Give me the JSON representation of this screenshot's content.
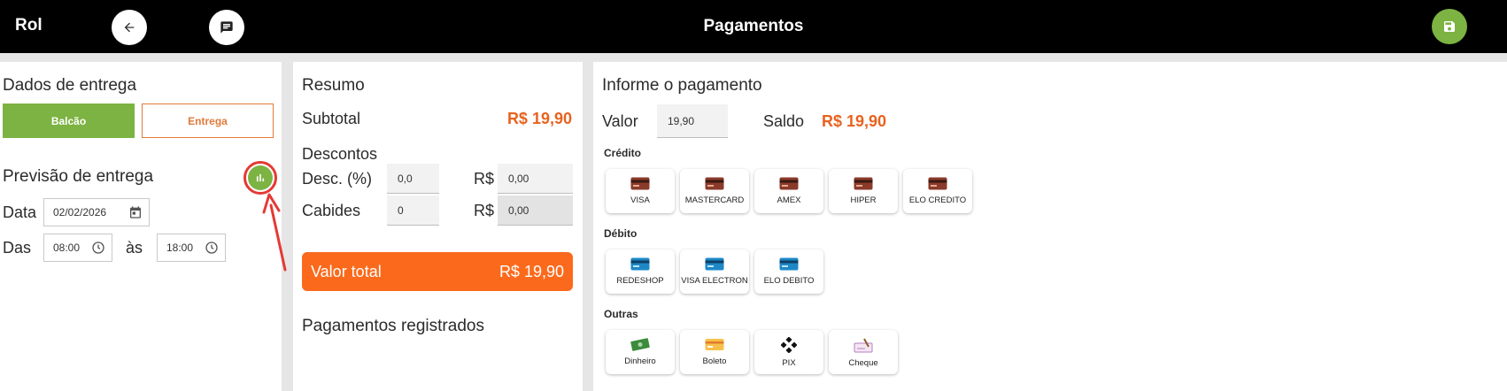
{
  "header": {
    "app_title": "Rol",
    "page_title": "Pagamentos",
    "back_icon": "arrow-left-icon",
    "chat_icon": "chat-icon",
    "save_icon": "save-icon",
    "save_color": "#7cb342"
  },
  "entrega": {
    "title": "Dados de entrega",
    "balcao_label": "Balcão",
    "entrega_label": "Entrega",
    "previsao_title": "Previsão de entrega",
    "data_label": "Data",
    "data_value": "02/02/2026",
    "das_label": "Das",
    "das_value": "08:00",
    "as_label": "às",
    "as_value": "18:00"
  },
  "resumo": {
    "title": "Resumo",
    "subtotal_label": "Subtotal",
    "subtotal_value": "R$ 19,90",
    "descontos_label": "Descontos",
    "desc_label": "Desc. (%)",
    "desc_percent_value": "0,0",
    "currency_label": "R$",
    "desc_value": "0,00",
    "cabides_label": "Cabides",
    "cabides_count": "0",
    "cabides_value": "0,00",
    "total_label": "Valor total",
    "total_value": "R$ 19,90",
    "pagamentos_title": "Pagamentos registrados"
  },
  "pagamento": {
    "title": "Informe o pagamento",
    "valor_label": "Valor",
    "valor_value": "19,90",
    "saldo_label": "Saldo",
    "saldo_value": "R$ 19,90",
    "credito_label": "Crédito",
    "credito": [
      {
        "label": "VISA",
        "icon": "credit-card-icon"
      },
      {
        "label": "MASTERCARD",
        "icon": "credit-card-icon"
      },
      {
        "label": "AMEX",
        "icon": "credit-card-icon"
      },
      {
        "label": "HIPER",
        "icon": "credit-card-icon"
      },
      {
        "label": "ELO CREDITO",
        "icon": "credit-card-icon"
      }
    ],
    "debito_label": "Débito",
    "debito": [
      {
        "label": "REDESHOP",
        "icon": "debit-card-icon"
      },
      {
        "label": "VISA ELECTRON",
        "icon": "debit-card-icon"
      },
      {
        "label": "ELO DEBITO",
        "icon": "debit-card-icon"
      }
    ],
    "outras_label": "Outras",
    "outras": [
      {
        "label": "Dinheiro",
        "icon": "cash-icon"
      },
      {
        "label": "Boleto",
        "icon": "boleto-icon"
      },
      {
        "label": "PIX",
        "icon": "pix-icon"
      },
      {
        "label": "Cheque",
        "icon": "cheque-icon"
      }
    ]
  },
  "colors": {
    "accent_green": "#7cb342",
    "accent_orange": "#fb6a1c",
    "highlight_red": "#e53935"
  }
}
